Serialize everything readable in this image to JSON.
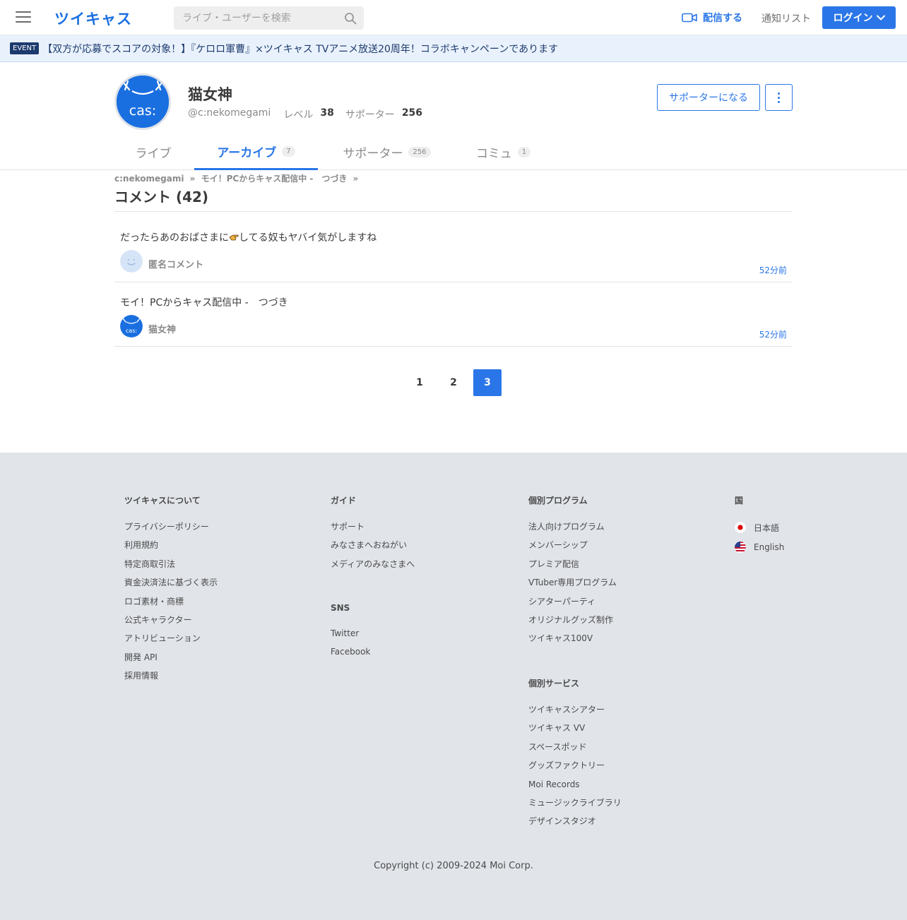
{
  "header": {
    "logo": "ツイキャス",
    "search_placeholder": "ライブ・ユーザーを検索",
    "broadcast_label": "配信する",
    "notify_label": "通知リスト",
    "login_label": "ログイン"
  },
  "event": {
    "badge": "EVENT",
    "text": "【双方が応募でスコアの対象！】『ケロロ軍曹』×ツイキャス TVアニメ放送20周年！コラボキャンペーンであります"
  },
  "profile": {
    "name": "猫女神",
    "handle": "@c:nekomegami",
    "level_label": "レベル",
    "level": "38",
    "supporter_label": "サポーター",
    "supporters": "256",
    "support_button": "サポーターになる",
    "avatar_text": "cas:"
  },
  "tabs": [
    {
      "label": "ライブ",
      "count": ""
    },
    {
      "label": "アーカイブ",
      "count": "7"
    },
    {
      "label": "サポーター",
      "count": "256"
    },
    {
      "label": "コミュ",
      "count": "1"
    }
  ],
  "breadcrumb": {
    "user": "c:nekomegami",
    "movie": "モイ！PCからキャス配信中 -　つづき",
    "sep": "»"
  },
  "page_title": "コメント (42)",
  "comments": [
    {
      "text_before": "だったらあのおばさまに",
      "text_after": "してる奴もヤバイ気がしますね",
      "user": "匿名コメント",
      "time": "52分前"
    },
    {
      "text": "モイ！PCからキャス配信中 -　つづき",
      "user": "猫女神",
      "time": "52分前"
    }
  ],
  "pagination": [
    "1",
    "2",
    "3"
  ],
  "footer": {
    "about": {
      "title": "ツイキャスについて",
      "links": [
        "プライバシーポリシー",
        "利用規約",
        "特定商取引法",
        "資金決済法に基づく表示",
        "ロゴ素材・商標",
        "公式キャラクター",
        "アトリビューション",
        "開発 API",
        "採用情報"
      ]
    },
    "guide": {
      "title": "ガイド",
      "links": [
        "サポート",
        "みなさまへおねがい",
        "メディアのみなさまへ"
      ]
    },
    "sns": {
      "title": "SNS",
      "links": [
        "Twitter",
        "Facebook"
      ]
    },
    "programs": {
      "title": "個別プログラム",
      "links": [
        "法人向けプログラム",
        "メンバーシップ",
        "プレミア配信",
        "VTuber専用プログラム",
        "シアターパーティ",
        "オリジナルグッズ制作",
        "ツイキャス100V"
      ]
    },
    "services": {
      "title": "個別サービス",
      "links": [
        "ツイキャスシアター",
        "ツイキャス VV",
        "スペースポッド",
        "グッズファクトリー",
        "Moi Records",
        "ミュージックライブラリ",
        "デザインスタジオ"
      ]
    },
    "country": {
      "title": "国",
      "langs": [
        "日本語",
        "English"
      ]
    },
    "copyright": "Copyright (c) 2009-2024 Moi Corp."
  },
  "colors": {
    "accent": "#2a76e8",
    "footer_bg": "#e1e4e9",
    "event_bg": "#e9f2fc"
  }
}
